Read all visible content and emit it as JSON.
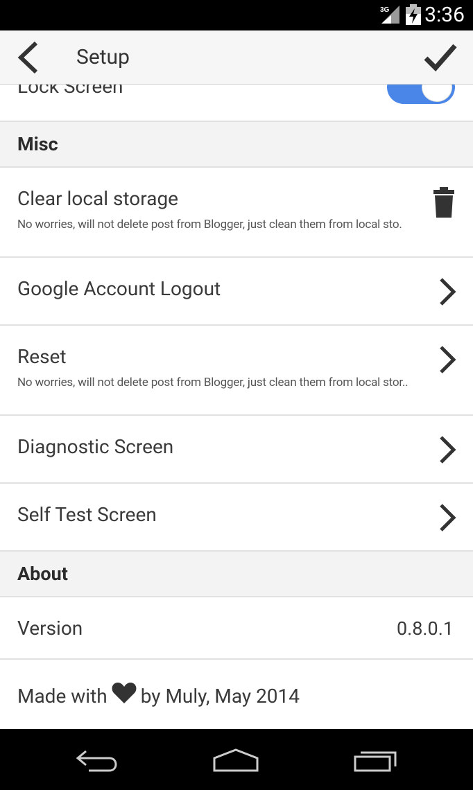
{
  "status_bar": {
    "network": "3G",
    "time": "3:36"
  },
  "app_bar": {
    "title": "Setup",
    "back_icon": "chevron-left-icon",
    "confirm_icon": "check-icon"
  },
  "settings": {
    "lock_screen": {
      "label": "Lock Screen",
      "enabled": true
    },
    "misc_header": "Misc",
    "clear_storage": {
      "label": "Clear local storage",
      "description": "No worries, will not delete post from Blogger, just clean them from local sto.",
      "icon": "trash-icon"
    },
    "google_logout": {
      "label": "Google Account Logout"
    },
    "reset": {
      "label": "Reset",
      "description": "No worries, will not delete post from Blogger, just clean them from local stor.."
    },
    "diagnostic": {
      "label": "Diagnostic Screen"
    },
    "self_test": {
      "label": "Self Test Screen"
    },
    "about_header": "About",
    "version": {
      "label": "Version",
      "value": "0.8.0.1"
    },
    "made_with": {
      "prefix": "Made with",
      "suffix": "by Muly, May 2014"
    }
  },
  "colors": {
    "accent": "#4a86e8",
    "section_bg": "#f3f3f3",
    "divider": "#e1e1e1"
  }
}
